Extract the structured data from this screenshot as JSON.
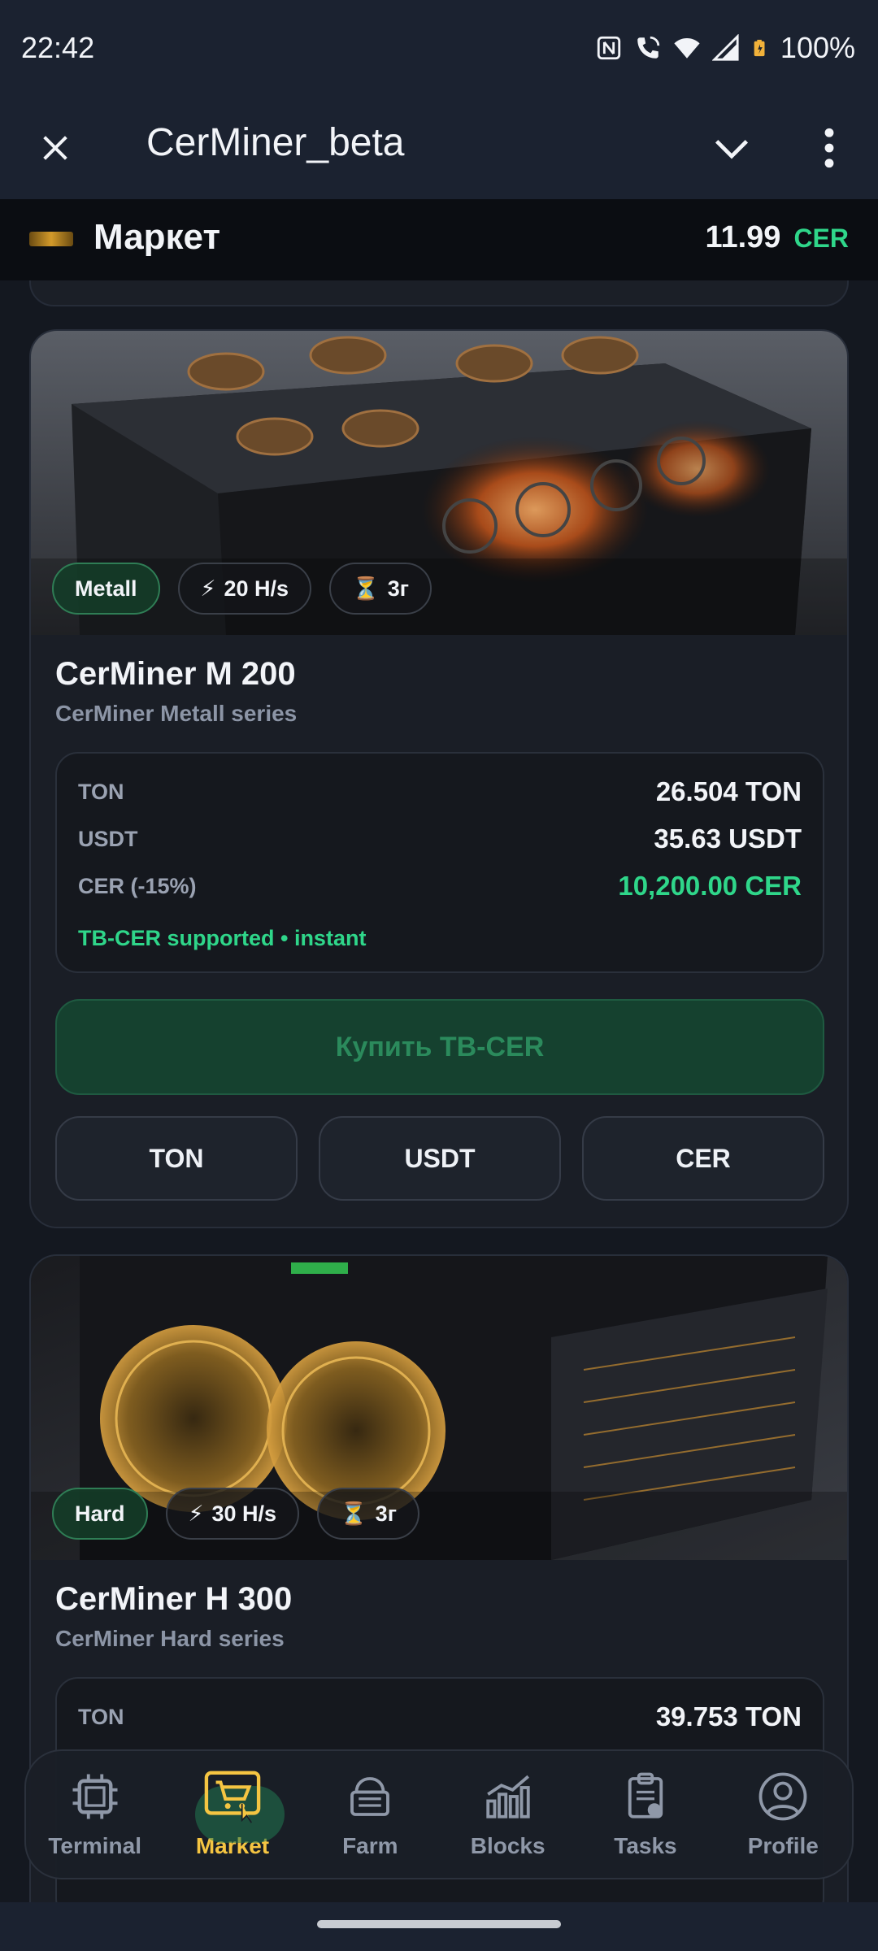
{
  "status_bar": {
    "time": "22:42",
    "battery": "100%",
    "icons": [
      "nfc-icon",
      "wifi-call-icon",
      "wifi-icon",
      "signal-icon",
      "battery-icon"
    ]
  },
  "app_bar": {
    "title": "CerMiner_beta",
    "icons": [
      "close-icon",
      "chevron-down-icon",
      "more-vert-icon"
    ]
  },
  "market_header": {
    "title": "Маркет",
    "balance_amount": "11.99",
    "balance_currency": "CER"
  },
  "cards": [
    {
      "series_chip": "Metall",
      "hashrate_chip": "20 H/s",
      "duration_chip": "3г",
      "name": "CerMiner M 200",
      "subtitle": "CerMiner Metall series",
      "prices": [
        {
          "label": "TON",
          "value": "26.504 TON"
        },
        {
          "label": "USDT",
          "value": "35.63 USDT"
        },
        {
          "label": "CER (-15%)",
          "value": "10,200.00 CER"
        }
      ],
      "supported_note": "TB-CER supported • instant",
      "buy_label": "Купить TB-CER",
      "pay_buttons": [
        "TON",
        "USDT",
        "CER"
      ]
    },
    {
      "series_chip": "Hard",
      "hashrate_chip": "30 H/s",
      "duration_chip": "3г",
      "name": "CerMiner H 300",
      "subtitle": "CerMiner Hard series",
      "prices": [
        {
          "label": "TON",
          "value": "39.753 TON"
        }
      ]
    }
  ],
  "bottom_nav": {
    "items": [
      {
        "label": "Terminal",
        "icon": "chip-icon"
      },
      {
        "label": "Market",
        "icon": "cart-icon",
        "active": true
      },
      {
        "label": "Farm",
        "icon": "farm-icon"
      },
      {
        "label": "Blocks",
        "icon": "chart-icon"
      },
      {
        "label": "Tasks",
        "icon": "clipboard-icon"
      },
      {
        "label": "Profile",
        "icon": "user-icon"
      }
    ]
  },
  "colors": {
    "accent_green": "#2fd68a",
    "active_nav": "#f5c542",
    "background": "#141820"
  }
}
